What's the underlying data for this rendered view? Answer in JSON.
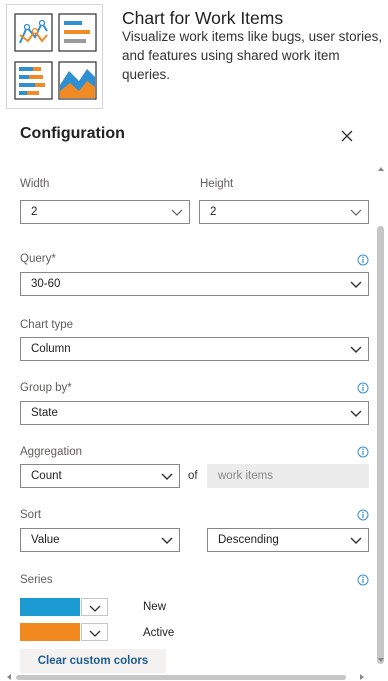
{
  "header": {
    "title": "Chart for Work Items",
    "description": "Visualize work items like bugs, user stories, and features using shared work item queries."
  },
  "config": {
    "title": "Configuration"
  },
  "width": {
    "label": "Width",
    "value": "2"
  },
  "height": {
    "label": "Height",
    "value": "2"
  },
  "query": {
    "label": "Query*",
    "value": "30-60"
  },
  "chart_type": {
    "label": "Chart type",
    "value": "Column"
  },
  "group_by": {
    "label": "Group by*",
    "value": "State"
  },
  "aggregation": {
    "label": "Aggregation",
    "value": "Count",
    "of_label": "of",
    "target": "work items"
  },
  "sort": {
    "label": "Sort",
    "field": "Value",
    "direction": "Descending"
  },
  "series": {
    "label": "Series",
    "items": [
      {
        "name": "New",
        "color": "#1a9ad1"
      },
      {
        "name": "Active",
        "color": "#f2891f"
      }
    ]
  },
  "clear_button": {
    "label": "Clear custom colors"
  },
  "colors": {
    "accent": "#1f5d90",
    "info_icon": "#3a8fd1"
  }
}
